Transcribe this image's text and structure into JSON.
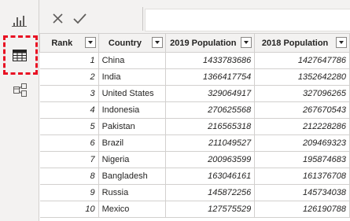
{
  "left_rail": {
    "icons": [
      "report-view-icon",
      "data-view-icon",
      "model-view-icon"
    ],
    "highlight_color": "#e81123"
  },
  "formula_bar": {
    "icons": [
      "close-icon",
      "checkmark-icon"
    ],
    "value": ""
  },
  "table": {
    "columns": [
      "Rank",
      "Country",
      "2019 Population",
      "2018 Population"
    ],
    "rows": [
      [
        "1",
        "China",
        "1433783686",
        "1427647786"
      ],
      [
        "2",
        "India",
        "1366417754",
        "1352642280"
      ],
      [
        "3",
        "United States",
        "329064917",
        "327096265"
      ],
      [
        "4",
        "Indonesia",
        "270625568",
        "267670543"
      ],
      [
        "5",
        "Pakistan",
        "216565318",
        "212228286"
      ],
      [
        "6",
        "Brazil",
        "211049527",
        "209469323"
      ],
      [
        "7",
        "Nigeria",
        "200963599",
        "195874683"
      ],
      [
        "8",
        "Bangladesh",
        "163046161",
        "161376708"
      ],
      [
        "9",
        "Russia",
        "145872256",
        "145734038"
      ],
      [
        "10",
        "Mexico",
        "127575529",
        "126190788"
      ]
    ]
  }
}
